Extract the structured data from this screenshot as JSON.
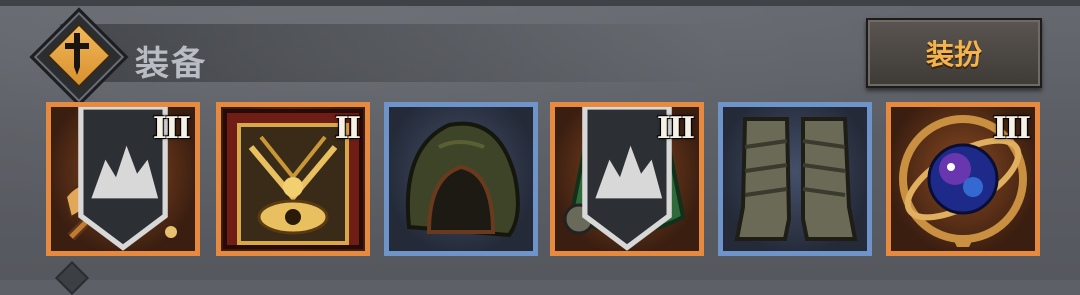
{
  "section": {
    "title": "装备",
    "equip_button_label": "装扮"
  },
  "slots": [
    {
      "name": "staff",
      "rarity": "orange",
      "tier": "III",
      "locked_banner": true
    },
    {
      "name": "tome",
      "rarity": "orange",
      "tier": "II",
      "locked_banner": false
    },
    {
      "name": "hood",
      "rarity": "blue",
      "tier": "",
      "locked_banner": false
    },
    {
      "name": "armor",
      "rarity": "orange",
      "tier": "III",
      "locked_banner": true
    },
    {
      "name": "boots",
      "rarity": "blue",
      "tier": "",
      "locked_banner": false
    },
    {
      "name": "orb",
      "rarity": "orange",
      "tier": "III",
      "locked_banner": false
    }
  ],
  "colors": {
    "orange_frame": "#e58a3f",
    "blue_frame": "#6f94c9",
    "button_text": "#f4b44d",
    "emblem": "#e8a544"
  },
  "icons": [
    "sword-icon",
    "staff-icon",
    "tome-icon",
    "hood-icon",
    "armor-icon",
    "boots-icon",
    "orb-icon",
    "locked-banner-icon"
  ]
}
